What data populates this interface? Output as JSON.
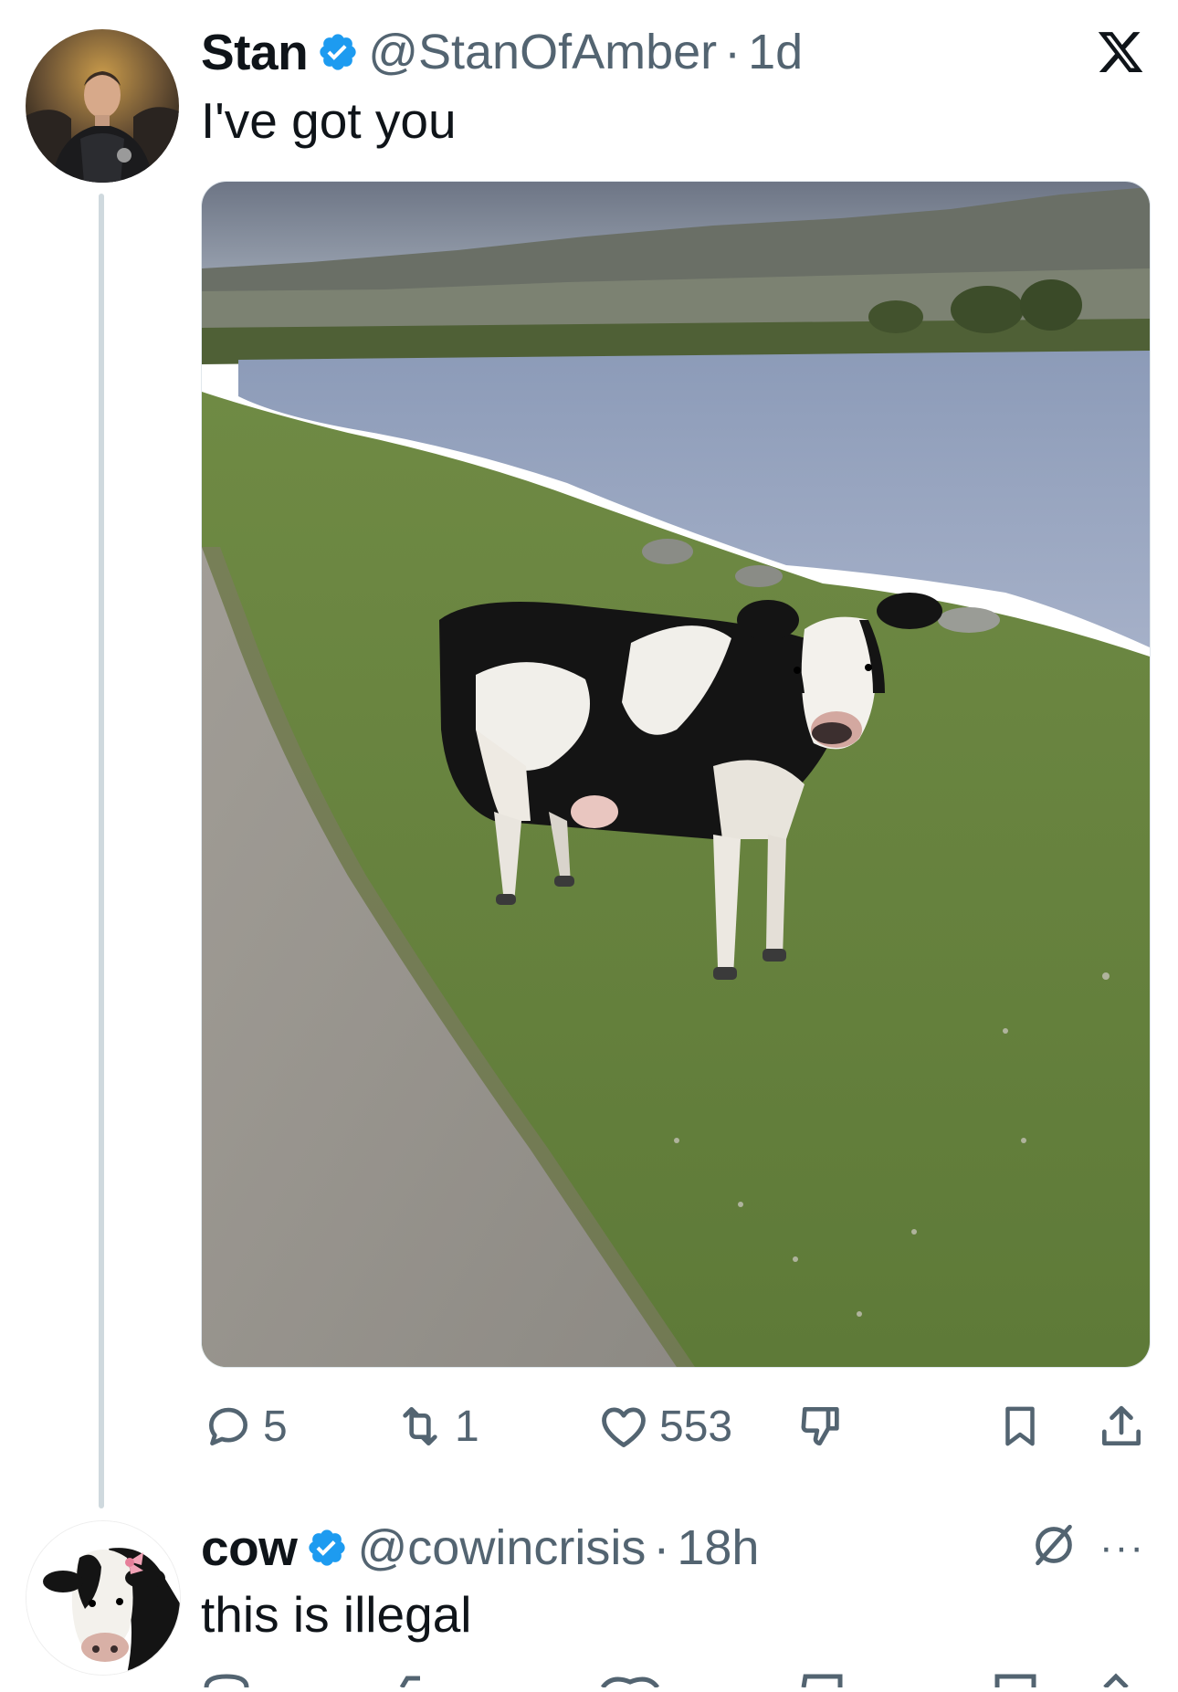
{
  "tweet1": {
    "display_name": "Stan",
    "handle": "@StanOfAmber",
    "separator": "·",
    "time": "1d",
    "text": "I've got you",
    "actions": {
      "reply_count": "5",
      "retweet_count": "1",
      "like_count": "553"
    }
  },
  "tweet2": {
    "display_name": "cow",
    "handle": "@cowincrisis",
    "separator": "·",
    "time": "18h",
    "text": "this is illegal",
    "more_label": "···"
  },
  "colors": {
    "text_primary": "#0f1419",
    "text_secondary": "#536471",
    "verified_blue": "#1d9bf0",
    "thread_line": "#cfd9de",
    "icon_gray": "#536471"
  },
  "icons": {
    "verified": "verified-badge-icon",
    "x_logo": "x-logo-icon",
    "reply": "reply-icon",
    "retweet": "retweet-icon",
    "like": "heart-icon",
    "dislike": "dislike-icon",
    "bookmark": "bookmark-icon",
    "share": "share-icon",
    "grok": "grok-icon",
    "more": "more-icon"
  }
}
